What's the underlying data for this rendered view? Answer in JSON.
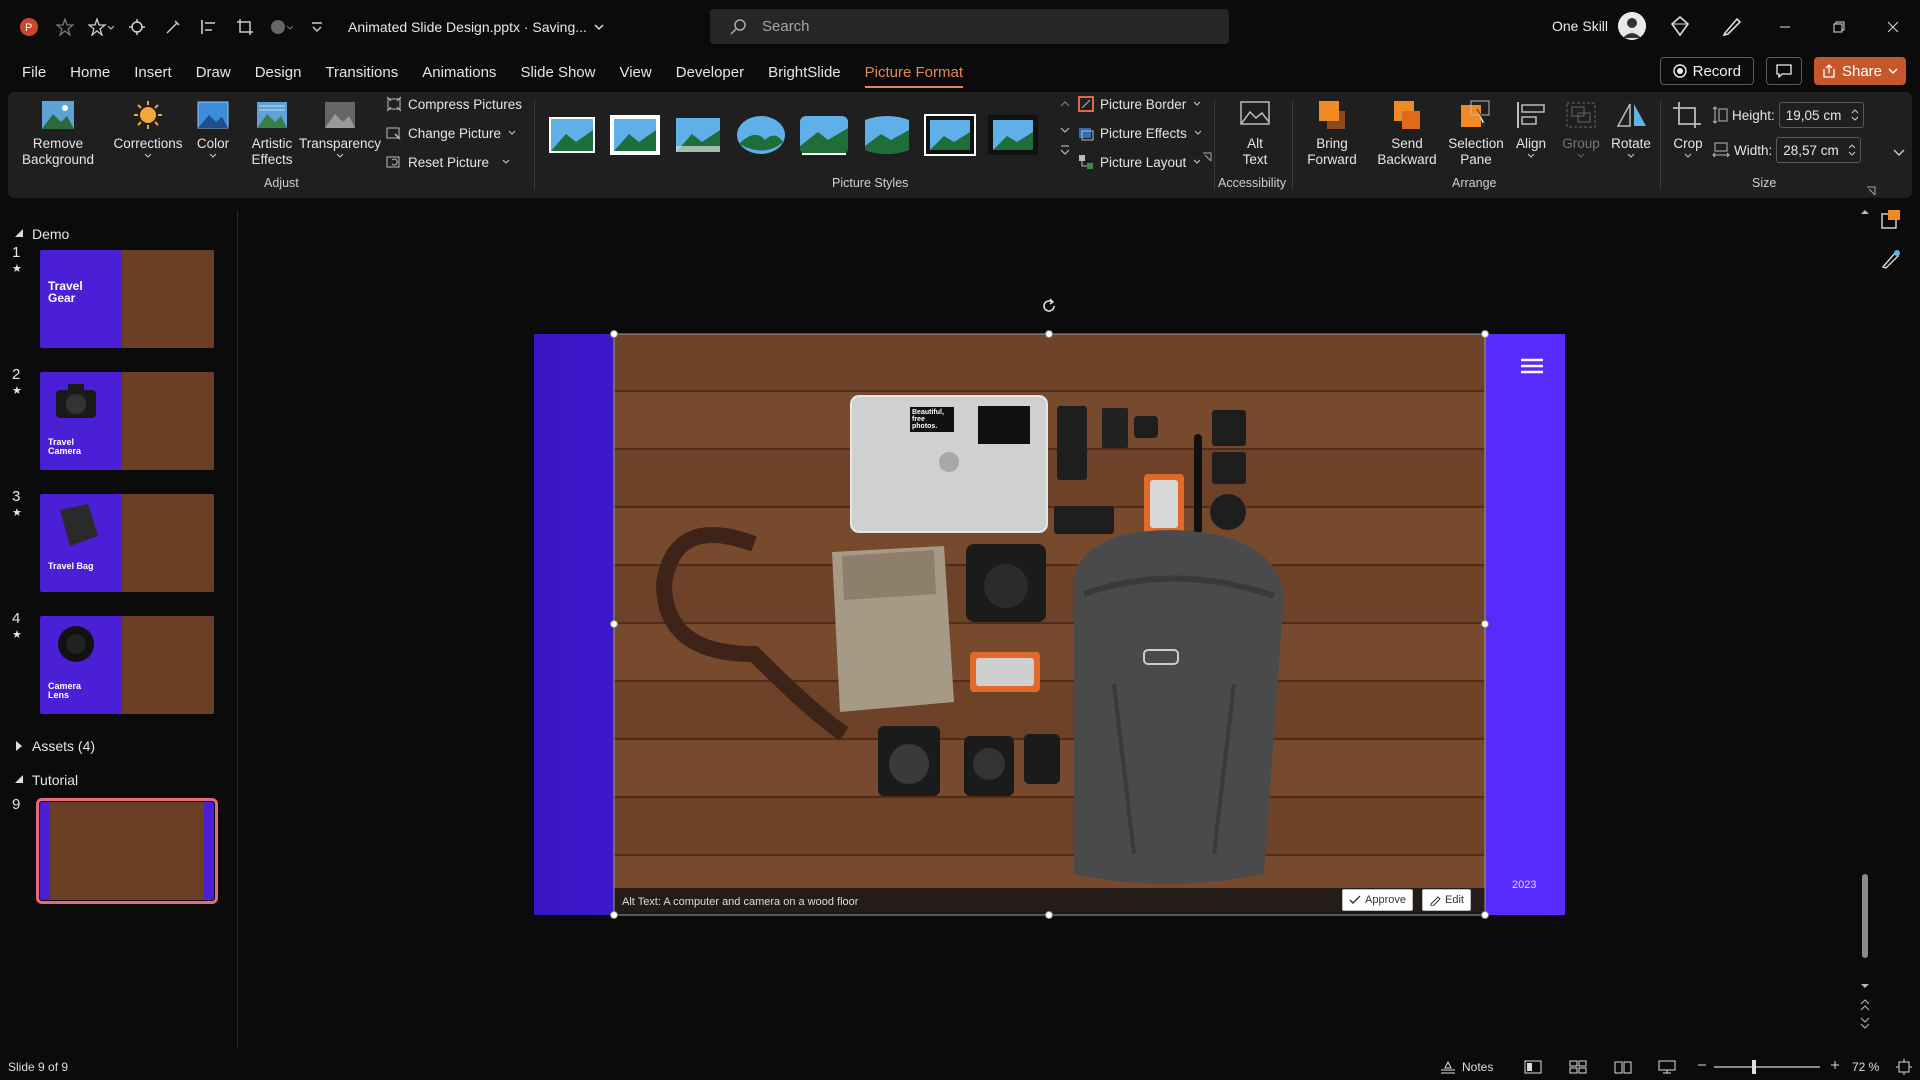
{
  "app": {
    "document_title": "Animated Slide Design.pptx · Saving...",
    "user_name": "One Skill"
  },
  "search": {
    "placeholder": "Search"
  },
  "tabs": [
    "File",
    "Home",
    "Insert",
    "Draw",
    "Design",
    "Transitions",
    "Animations",
    "Slide Show",
    "View",
    "Developer",
    "BrightSlide",
    "Picture Format"
  ],
  "active_tab": "Picture Format",
  "tab_actions": {
    "record": "Record",
    "share": "Share"
  },
  "ribbon": {
    "adjust": {
      "remove_background": "Remove Background",
      "corrections": "Corrections",
      "color": "Color",
      "artistic_effects": "Artistic Effects",
      "transparency": "Transparency",
      "compress_pictures": "Compress Pictures",
      "change_picture": "Change Picture",
      "reset_picture": "Reset Picture",
      "group_label": "Adjust"
    },
    "picture_styles": {
      "picture_border": "Picture Border",
      "picture_effects": "Picture Effects",
      "picture_layout": "Picture Layout",
      "group_label": "Picture Styles"
    },
    "accessibility": {
      "alt_text": "Alt Text",
      "group_label": "Accessibility"
    },
    "arrange": {
      "bring_forward": "Bring Forward",
      "send_backward": "Send Backward",
      "selection_pane": "Selection Pane",
      "align": "Align",
      "group": "Group",
      "rotate": "Rotate",
      "group_label": "Arrange"
    },
    "size": {
      "crop": "Crop",
      "height_label": "Height:",
      "height_value": "19,05 cm",
      "width_label": "Width:",
      "width_value": "28,57 cm",
      "group_label": "Size"
    }
  },
  "slides_panel": {
    "sections": [
      {
        "name": "Demo"
      },
      {
        "name": "Assets (4)"
      },
      {
        "name": "Tutorial"
      }
    ],
    "slides": [
      {
        "number": "1",
        "title": "Travel Gear"
      },
      {
        "number": "2",
        "title": "Travel Camera"
      },
      {
        "number": "3",
        "title": "Travel Bag"
      },
      {
        "number": "4",
        "title": "Camera Lens"
      },
      {
        "number": "9",
        "title": ""
      }
    ]
  },
  "slide": {
    "alt_text": "Alt Text: A computer and camera on a wood floor",
    "approve": "Approve",
    "edit": "Edit",
    "year": "2023",
    "sticker_text": "Beautiful, free photos."
  },
  "status": {
    "slide_info": "Slide 9 of 9",
    "notes": "Notes",
    "zoom": "72 %"
  },
  "colors": {
    "accent": "#e6875a",
    "slide_purple": "#4a22e6",
    "share": "#c4572b"
  }
}
